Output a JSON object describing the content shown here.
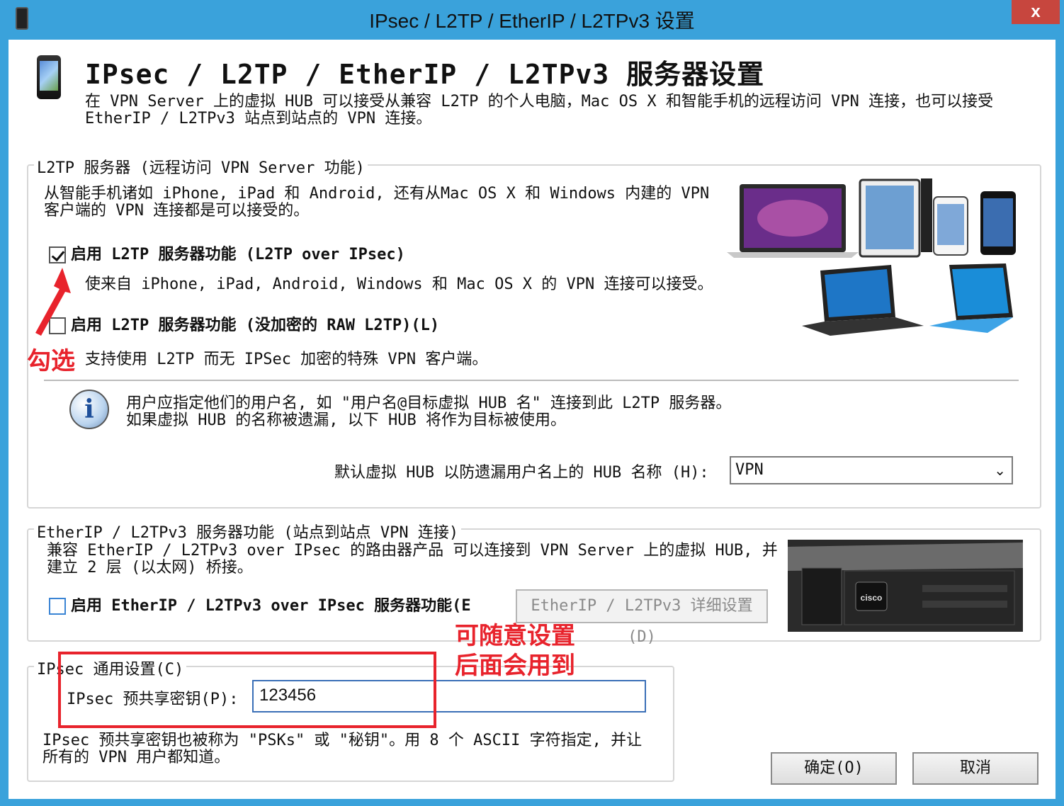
{
  "window": {
    "title": "IPsec / L2TP / EtherIP / L2TPv3 设置",
    "close_label": "x"
  },
  "header": {
    "title": "IPsec / L2TP / EtherIP / L2TPv3 服务器设置",
    "desc_line1": "在 VPN Server 上的虚拟 HUB 可以接受从兼容 L2TP 的个人电脑，Mac OS X 和智能手机的远程访问 VPN 连接，也可以接受",
    "desc_line2": "EtherIP / L2TPv3 站点到站点的 VPN 连接。"
  },
  "l2tp": {
    "legend": "L2TP 服务器 (远程访问 VPN Server 功能)",
    "intro_line1": "从智能手机诸如 iPhone, iPad 和 Android, 还有从Mac OS X 和 Windows 内建的 VPN",
    "intro_line2": "客户端的 VPN 连接都是可以接受的。",
    "ipsec_checkbox_label": "启用 L2TP 服务器功能 (L2TP over IPsec)",
    "ipsec_checked": true,
    "ipsec_note": "使来自 iPhone, iPad, Android, Windows 和 Mac OS X 的 VPN 连接可以接受。",
    "raw_checkbox_label": "启用 L2TP 服务器功能 (没加密的 RAW L2TP)(L)",
    "raw_checked": false,
    "raw_note": "支持使用 L2TP 而无 IPSec 加密的特殊 VPN 客户端。",
    "info_line1": "用户应指定他们的用户名, 如 \"用户名@目标虚拟 HUB 名\" 连接到此 L2TP 服务器。",
    "info_line2": "如果虚拟 HUB 的名称被遗漏, 以下 HUB 将作为目标被使用。",
    "default_hub_label": "默认虚拟 HUB 以防遗漏用户名上的 HUB 名称 (H):",
    "default_hub_value": "VPN"
  },
  "etherip": {
    "legend": "EtherIP / L2TPv3 服务器功能 (站点到站点 VPN 连接)",
    "intro_line1": "兼容 EtherIP / L2TPv3 over IPsec 的路由器产品 可以连接到 VPN Server 上的虚拟 HUB, 并",
    "intro_line2": "建立 2 层 (以太网) 桥接。",
    "checkbox_label": "启用 EtherIP / L2TPv3 over IPsec 服务器功能(E",
    "checked": false,
    "detail_button": "EtherIP / L2TPv3 详细设置(D)",
    "router_brand": "cisco"
  },
  "ipsec": {
    "legend": "IPsec 通用设置(C)",
    "psk_label": "IPsec 预共享密钥(P):",
    "psk_value": "123456",
    "note_line1": "IPsec 预共享密钥也被称为 \"PSKs\" 或 \"秘钥\"。用 8 个 ASCII 字符指定, 并让",
    "note_line2": "所有的 VPN 用户都知道。"
  },
  "buttons": {
    "ok": "确定(O)",
    "cancel": "取消"
  },
  "annotations": {
    "check_hint": "勾选",
    "psk_hint_line1": "可随意设置",
    "psk_hint_line2": "后面会用到",
    "color": "#e8232c"
  }
}
